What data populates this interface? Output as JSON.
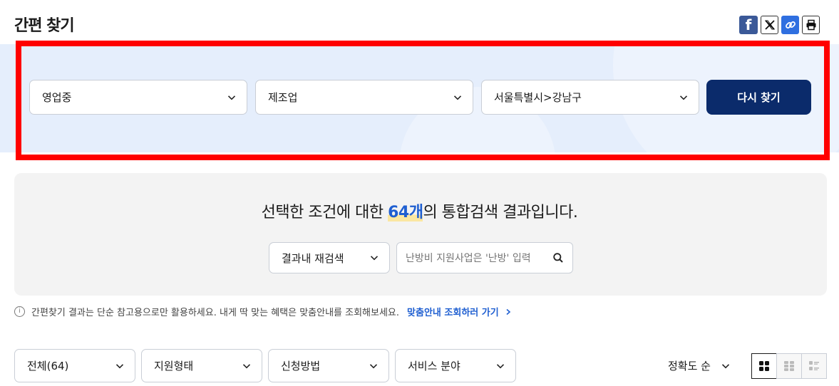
{
  "page": {
    "title": "간편 찾기"
  },
  "share": {
    "facebook_label": "f"
  },
  "filters": {
    "status": "영업중",
    "industry": "제조업",
    "region": "서울특별시>강남구",
    "search_again_label": "다시 찾기"
  },
  "result": {
    "prefix": "선택한 조건에 대한 ",
    "count": "64개",
    "suffix": "의 통합검색 결과입니다.",
    "research_scope": "결과내 재검색",
    "search_placeholder": "난방비 지원사업은 '난방' 입력"
  },
  "notice": {
    "text": "간편찾기 결과는 단순 참고용으로만 활용하세요. 내게 딱 맞는 혜택은 맞춤안내를 조회해보세요.",
    "link_label": "맞춤안내 조회하러 가기"
  },
  "list_filters": {
    "all": "전체(64)",
    "support_type": "지원형태",
    "apply_method": "신청방법",
    "service_field": "서비스 분야"
  },
  "sort": {
    "label": "정확도 순"
  },
  "colors": {
    "accent": "#0b2b6b",
    "link": "#1f5fd1",
    "highlight_frame": "#ff0000",
    "band": "#e5eefc"
  },
  "icons": [
    "facebook-icon",
    "x-icon",
    "link-icon",
    "print-icon",
    "chevron-down-icon",
    "search-icon",
    "info-icon",
    "chevron-right-icon",
    "grid-view-icon",
    "card-view-icon",
    "list-view-icon"
  ]
}
